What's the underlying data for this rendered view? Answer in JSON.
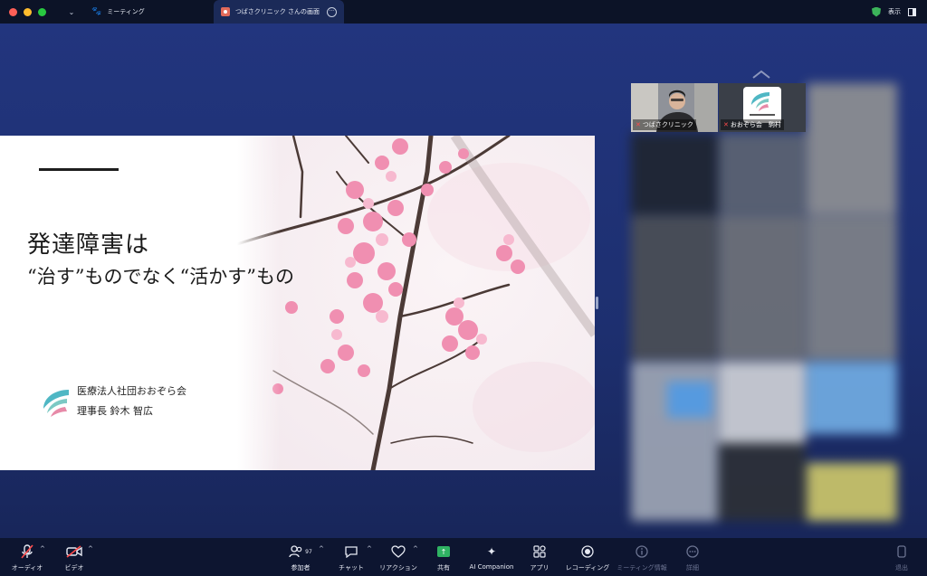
{
  "titlebar": {
    "meeting_tab": "ミーティング",
    "share_tab": "つばさクリニック さんの画面",
    "view_label": "表示"
  },
  "slide": {
    "heading_line1": "発達障害は",
    "heading_line2": "“治す”ものでなく“活かす”もの",
    "organization": "医療法人社団おおぞら会",
    "presenter": "理事長 鈴木 智広"
  },
  "gallery": {
    "tiles": [
      {
        "name": "つばさクリニック"
      },
      {
        "name": "おおぞら会　駒村"
      }
    ]
  },
  "toolbar": {
    "audio": "オーディオ",
    "video": "ビデオ",
    "participants": "参加者",
    "participant_count": "97",
    "chat": "チャット",
    "reactions": "リアクション",
    "share": "共有",
    "ai_companion": "AI Companion",
    "apps": "アプリ",
    "recording": "レコーディング",
    "meeting_info": "ミーティング情報",
    "more": "詳細",
    "leave": "退出"
  },
  "colors": {
    "accent_green": "#2fb363",
    "stage_blue": "#22357e",
    "mute_red": "#ff4b4b"
  }
}
